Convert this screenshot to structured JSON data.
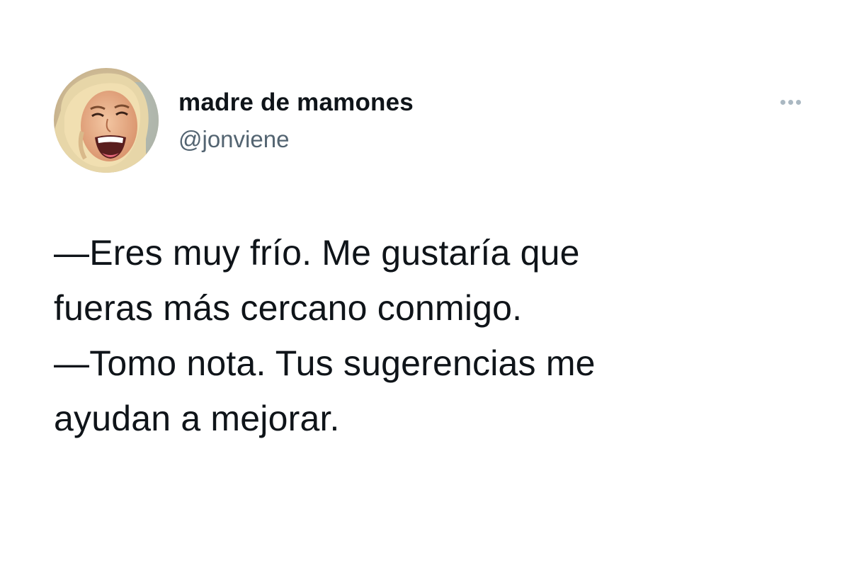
{
  "tweet": {
    "author": {
      "display_name": "madre de mamones",
      "handle": "@jonviene",
      "avatar_icon": "laughing-woman-avatar"
    },
    "more_icon": "more-options-icon",
    "text_lines": [
      "—Eres muy frío. Me gustaría que",
      "fueras más cercano conmigo.",
      "—Tomo nota. Tus sugerencias me",
      "ayudan a mejorar."
    ]
  },
  "colors": {
    "text": "#0f1419",
    "secondary_text": "#536471",
    "more_icon": "#aab8c2",
    "background": "#ffffff"
  }
}
